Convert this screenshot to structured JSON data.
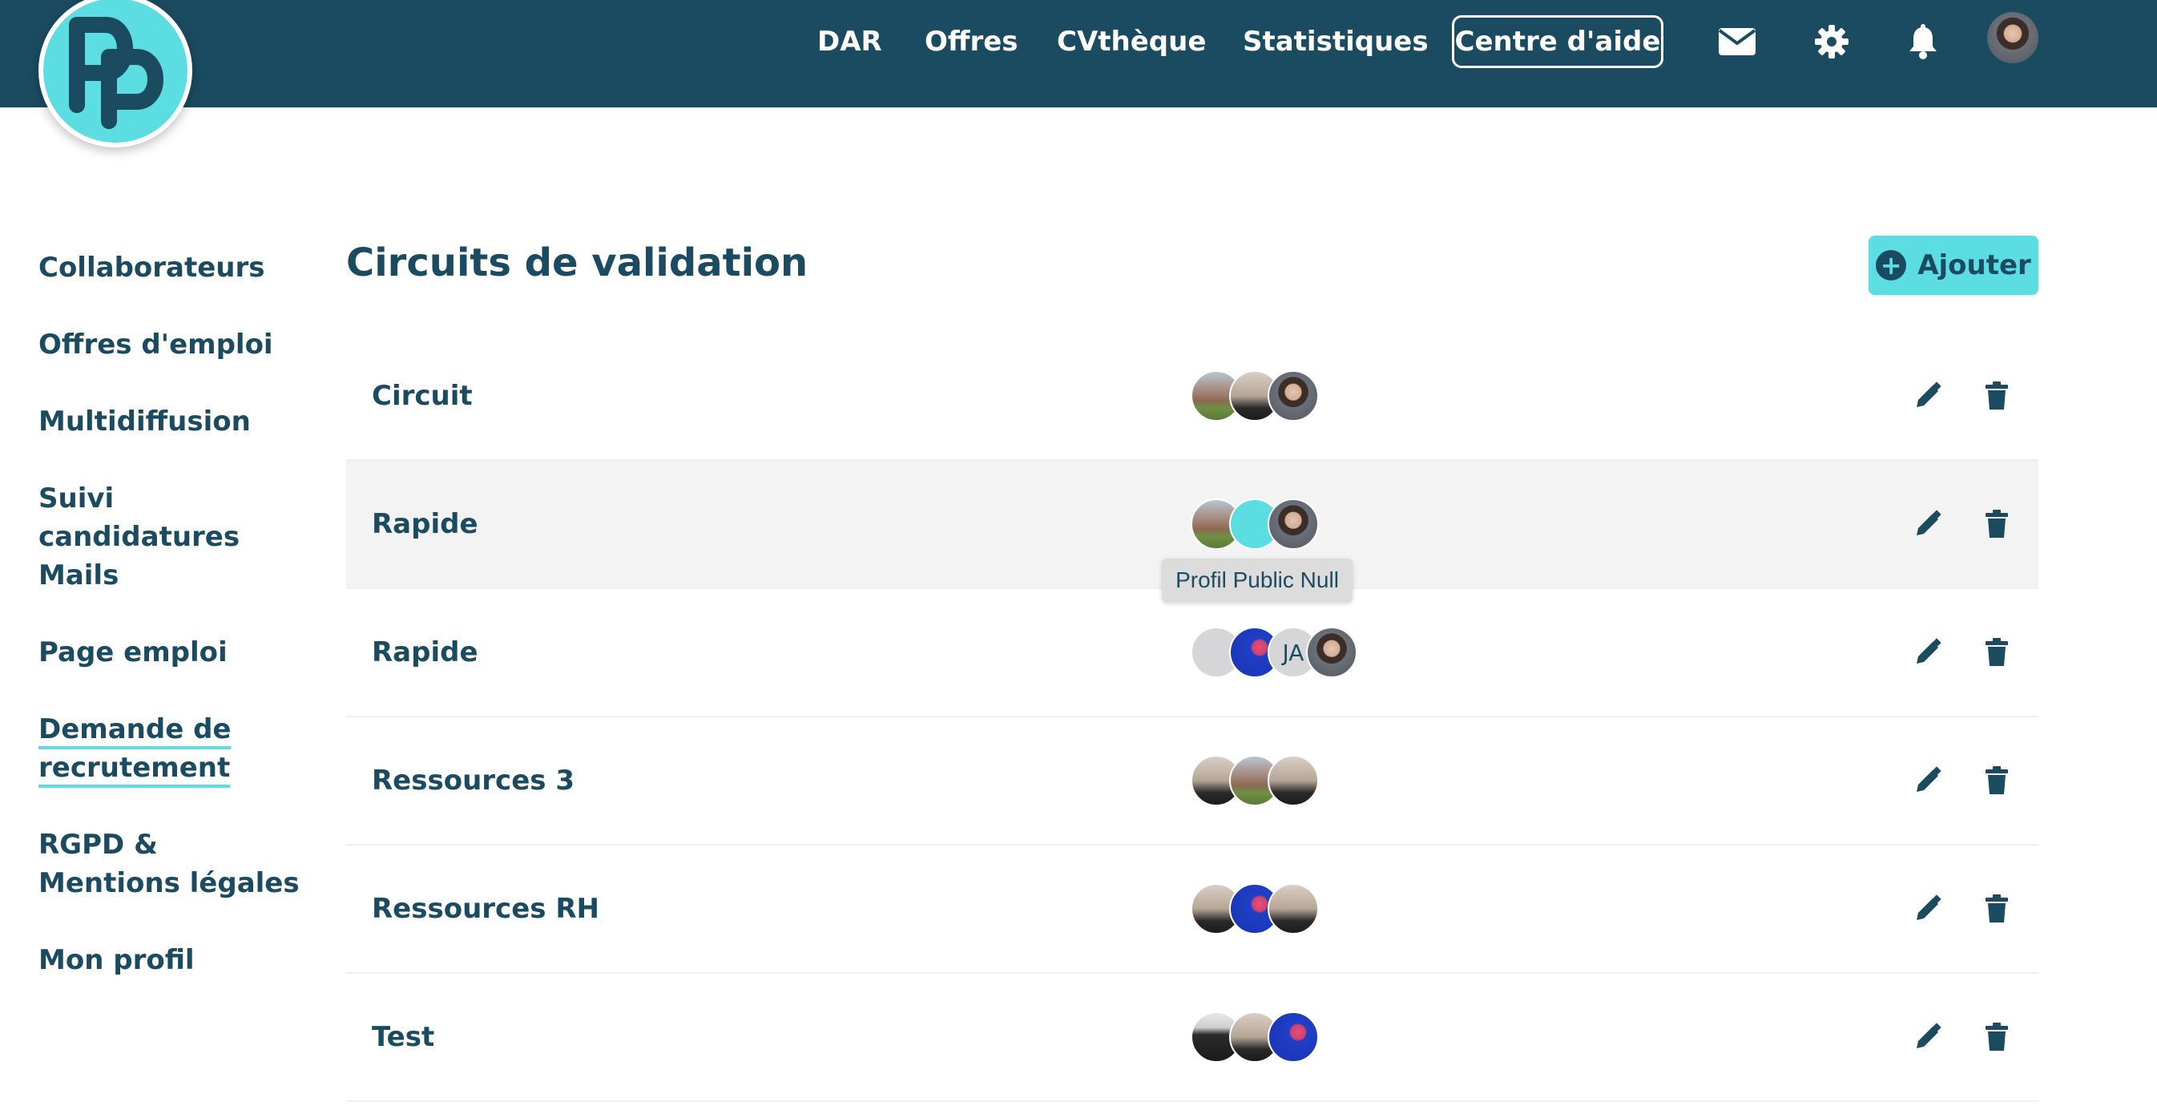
{
  "header": {
    "logo_alt": "PP",
    "nav": [
      "DAR",
      "Offres",
      "CVthèque",
      "Statistiques"
    ],
    "help_label": "Centre d'aide",
    "icons": [
      "envelope-icon",
      "gear-icon",
      "bell-icon"
    ],
    "colors": {
      "bar": "#1b4b60",
      "accent": "#5cdde1"
    }
  },
  "sidebar": {
    "items": [
      {
        "label": "Collaborateurs"
      },
      {
        "label": "Offres d'emploi"
      },
      {
        "label": "Multidiffusion"
      },
      {
        "label": "Suivi candidatures"
      },
      {
        "label": "Mails"
      },
      {
        "label": "Page emploi"
      },
      {
        "label": "Demande de recrutement",
        "active": true
      },
      {
        "label": "RGPD & Mentions légales"
      },
      {
        "label": "Mon profil"
      }
    ]
  },
  "main": {
    "title": "Circuits de validation",
    "add_label": "Ajouter",
    "tooltip": "Profil Public Null",
    "rows": [
      {
        "name": "Circuit"
      },
      {
        "name": "Rapide"
      },
      {
        "name": "Rapide",
        "initials": "JA"
      },
      {
        "name": "Ressources 3"
      },
      {
        "name": "Ressources RH"
      },
      {
        "name": "Test"
      }
    ]
  }
}
